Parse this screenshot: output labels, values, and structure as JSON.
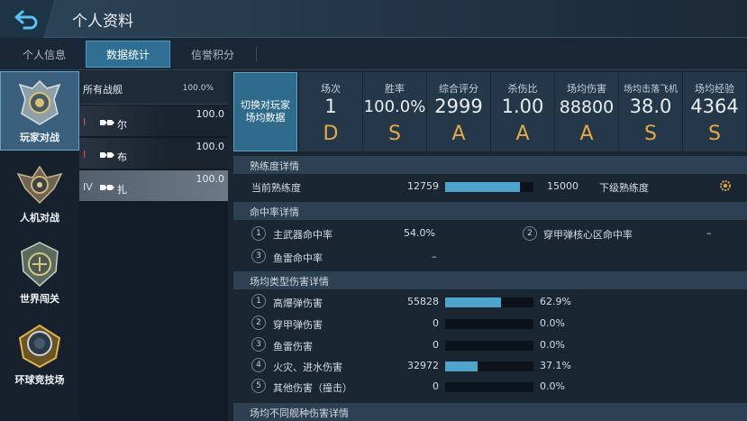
{
  "header": {
    "title": "个人资料",
    "back_icon": "back-arrow-icon"
  },
  "tabs": [
    {
      "label": "个人信息",
      "active": false
    },
    {
      "label": "数据统计",
      "active": true
    },
    {
      "label": "信誉积分",
      "active": false
    }
  ],
  "modes": [
    {
      "label": "玩家对战",
      "active": true,
      "icon": "pvp-emblem-icon"
    },
    {
      "label": "人机对战",
      "active": false,
      "icon": "pve-emblem-icon"
    },
    {
      "label": "世界闯关",
      "active": false,
      "icon": "world-emblem-icon"
    },
    {
      "label": "环球竞技场",
      "active": false,
      "icon": "arena-emblem-icon"
    }
  ],
  "ship_list": {
    "all_label": "所有战舰",
    "all_pct": "100.0%",
    "ships": [
      {
        "tier": "I",
        "name": "尔",
        "pct": "100.0",
        "selected": false,
        "tier_color": "#e25050"
      },
      {
        "tier": "I",
        "name": "布",
        "pct": "100.0",
        "selected": false,
        "tier_color": "#e25050"
      },
      {
        "tier": "IV",
        "name": "扎",
        "pct": "100.0",
        "selected": true,
        "tier_color": "#d8dee5"
      }
    ]
  },
  "switch_button": "切换对玩家场均数据",
  "summary": [
    {
      "label": "场次",
      "value": "1",
      "grade": "D"
    },
    {
      "label": "胜率",
      "value": "100.0%",
      "grade": "S"
    },
    {
      "label": "综合评分",
      "value": "2999",
      "grade": "A"
    },
    {
      "label": "杀伤比",
      "value": "1.00",
      "grade": "A"
    },
    {
      "label": "场均伤害",
      "value": "88800",
      "grade": "A"
    },
    {
      "label": "场均击落飞机",
      "value": "38.0",
      "grade": "S"
    },
    {
      "label": "场均经验",
      "value": "4364",
      "grade": "S"
    }
  ],
  "proficiency": {
    "title": "熟练度详情",
    "current_label": "当前熟练度",
    "current_value": "12759",
    "next_value": "15000",
    "next_label": "下级熟练度",
    "progress": 0.85
  },
  "hit_rate": {
    "title": "命中率详情",
    "items": [
      {
        "n": "1",
        "label": "主武器命中率",
        "value": "54.0%"
      },
      {
        "n": "2",
        "label": "穿甲弹核心区命中率",
        "value": "–"
      },
      {
        "n": "3",
        "label": "鱼雷命中率",
        "value": "–"
      }
    ]
  },
  "damage_types": {
    "title": "场均类型伤害详情",
    "items": [
      {
        "n": "1",
        "label": "高爆弹伤害",
        "value": "55828",
        "pct": "62.9%",
        "ratio": 0.629
      },
      {
        "n": "2",
        "label": "穿甲弹伤害",
        "value": "0",
        "pct": "0.0%",
        "ratio": 0
      },
      {
        "n": "3",
        "label": "鱼雷伤害",
        "value": "0",
        "pct": "0.0%",
        "ratio": 0
      },
      {
        "n": "4",
        "label": "火灾、进水伤害",
        "value": "32972",
        "pct": "37.1%",
        "ratio": 0.371
      },
      {
        "n": "5",
        "label": "其他伤害（撞击）",
        "value": "0",
        "pct": "0.0%",
        "ratio": 0
      }
    ]
  },
  "ship_damage_title": "场均不同舰种伤害详情",
  "colors": {
    "accent": "#4fa4cc",
    "grade": "#e6a94a",
    "tab_active": "#2e6f93"
  }
}
